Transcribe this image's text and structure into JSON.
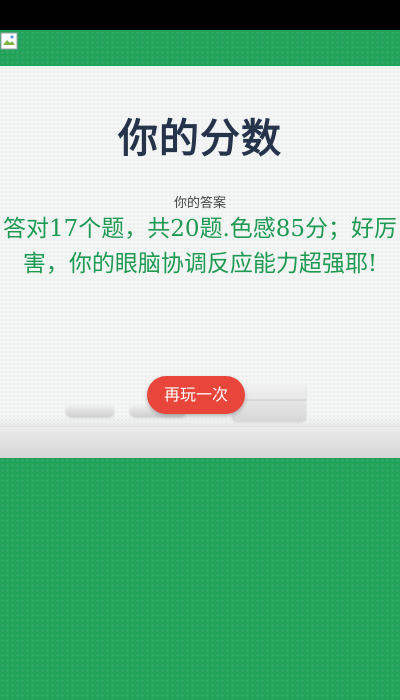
{
  "page": {
    "title": "你的分数",
    "answer_label": "你的答案",
    "result_text": "答对17个题，共20题.色感85分；好厉害，你的眼脑协调反应能力超强耶!",
    "replay_button_label": "再玩一次"
  },
  "colors": {
    "green_background": "#22a35a",
    "title_color": "#25344a",
    "result_color": "#1e9a52",
    "button_color": "#e8463b"
  },
  "icons": {
    "broken_image": "broken-image-icon"
  }
}
